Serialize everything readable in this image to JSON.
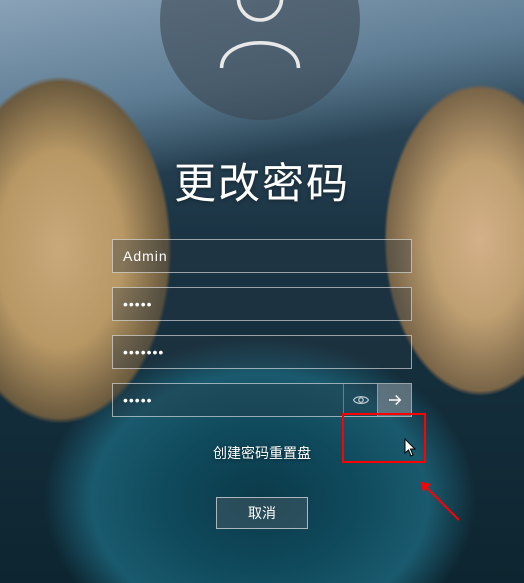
{
  "title": "更改密码",
  "fields": {
    "username": {
      "value": "Admin"
    },
    "old_password": {
      "value": "•••••"
    },
    "new_password": {
      "value": "•••••••"
    },
    "confirm_password": {
      "value": "•••••"
    }
  },
  "link": {
    "label": "创建密码重置盘"
  },
  "buttons": {
    "cancel": "取消"
  },
  "icons": {
    "avatar": "user-icon",
    "reveal": "eye-icon",
    "submit": "arrow-right-icon"
  }
}
